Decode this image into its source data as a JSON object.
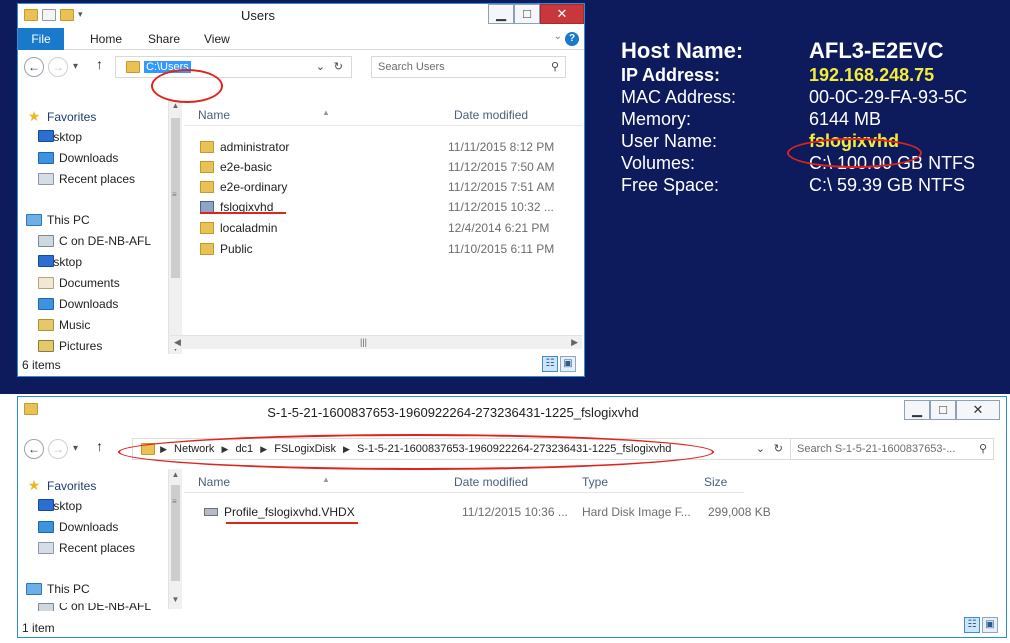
{
  "bginfo": {
    "host_label": "Host Name:",
    "host_value": "AFL3-E2EVC",
    "ip_label": "IP Address:",
    "ip_value": "192.168.248.75",
    "mac_label": "MAC Address:",
    "mac_value": "00-0C-29-FA-93-5C",
    "mem_label": "Memory:",
    "mem_value": "6144 MB",
    "user_label": "User Name:",
    "user_value": "fslogixvhd",
    "vol_label": "Volumes:",
    "vol_value": "C:\\ 100.00 GB NTFS",
    "free_label": "Free Space:",
    "free_value": "C:\\ 59.39 GB NTFS",
    "highlight_color": "#f3ec3a"
  },
  "win1": {
    "title": "Users",
    "ribbon": {
      "file": "File",
      "home": "Home",
      "share": "Share",
      "view": "View"
    },
    "address": "C:\\Users",
    "search_placeholder": "Search Users",
    "nav": {
      "favorites": "Favorites",
      "desktop": "Desktop",
      "downloads": "Downloads",
      "recent": "Recent places",
      "this_pc": "This PC",
      "c_on": "C on DE-NB-AFL",
      "desktop2": "Desktop",
      "documents": "Documents",
      "downloads2": "Downloads",
      "music": "Music",
      "pictures": "Pictures"
    },
    "columns": {
      "name": "Name",
      "date": "Date modified"
    },
    "rows": [
      {
        "name": "administrator",
        "date": "11/11/2015 8:12 PM"
      },
      {
        "name": "e2e-basic",
        "date": "11/12/2015 7:50 AM"
      },
      {
        "name": "e2e-ordinary",
        "date": "11/12/2015 7:51 AM"
      },
      {
        "name": "fslogixvhd",
        "date": "11/12/2015 10:32 ..."
      },
      {
        "name": "localadmin",
        "date": "12/4/2014 6:21 PM"
      },
      {
        "name": "Public",
        "date": "11/10/2015 6:11 PM"
      }
    ],
    "status": "6 items"
  },
  "win2": {
    "title": "S-1-5-21-1600837653-1960922264-273236431-1225_fslogixvhd",
    "crumbs": [
      "Network",
      "dc1",
      "FSLogixDisk",
      "S-1-5-21-1600837653-1960922264-273236431-1225_fslogixvhd"
    ],
    "search_placeholder": "Search S-1-5-21-1600837653-...",
    "nav": {
      "favorites": "Favorites",
      "desktop": "Desktop",
      "downloads": "Downloads",
      "recent": "Recent places",
      "this_pc": "This PC",
      "c_on": "C on DE-NB-AFL"
    },
    "columns": {
      "name": "Name",
      "date": "Date modified",
      "type": "Type",
      "size": "Size"
    },
    "rows": [
      {
        "name": "Profile_fslogixvhd.VHDX",
        "date": "11/12/2015 10:36 ...",
        "type": "Hard Disk Image F...",
        "size": "299,008 KB"
      }
    ],
    "status": "1 item"
  },
  "icons": {
    "search": "search-icon",
    "refresh": "refresh-icon",
    "back": "back-arrow-icon",
    "forward": "forward-arrow-icon",
    "up": "up-arrow-icon",
    "folder": "folder-icon"
  },
  "colors": {
    "annotation_red": "#e0241d",
    "desktop_bg": "#0d1a5c",
    "file_tab": "#1979ca"
  }
}
